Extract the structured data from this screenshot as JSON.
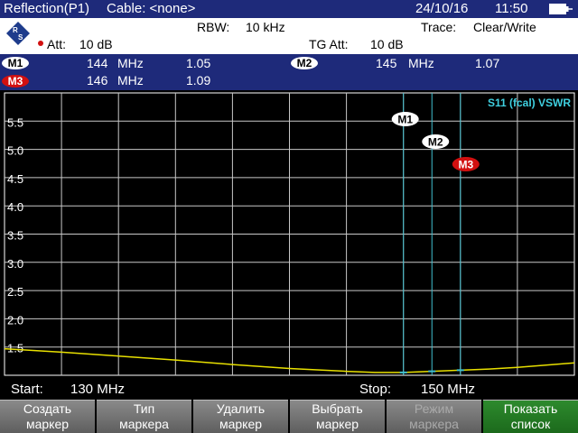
{
  "title_bar": {
    "mode": "Reflection(P1)",
    "cable": "Cable: <none>",
    "date": "24/10/16",
    "time": "11:50"
  },
  "info": {
    "rbw_label": "RBW:",
    "rbw_value": "10 kHz",
    "trace_label": "Trace:",
    "trace_value": "Clear/Write",
    "att_label": "Att:",
    "att_value": "10 dB",
    "tg_att_label": "TG Att:",
    "tg_att_value": "10 dB"
  },
  "markers": [
    {
      "label": "M1",
      "freq": "144",
      "unit": "MHz",
      "value": "1.05",
      "style": "white"
    },
    {
      "label": "M2",
      "freq": "145",
      "unit": "MHz",
      "value": "1.07",
      "style": "white"
    },
    {
      "label": "M3",
      "freq": "146",
      "unit": "MHz",
      "value": "1.09",
      "style": "red"
    }
  ],
  "plot": {
    "trace_label": "S11 (fcal) VSWR",
    "y_ticks": [
      "5.5",
      "5.0",
      "4.5",
      "4.0",
      "3.5",
      "3.0",
      "2.5",
      "2.0",
      "1.5"
    ]
  },
  "freq": {
    "start_label": "Start:",
    "start_value": "130 MHz",
    "stop_label": "Stop:",
    "stop_value": "150 MHz"
  },
  "softkeys": [
    {
      "line1": "Создать",
      "line2": "маркер",
      "state": "normal"
    },
    {
      "line1": "Тип",
      "line2": "маркера",
      "state": "normal"
    },
    {
      "line1": "Удалить",
      "line2": "маркер",
      "state": "normal"
    },
    {
      "line1": "Выбрать",
      "line2": "маркер",
      "state": "normal"
    },
    {
      "line1": "Режим",
      "line2": "маркера",
      "state": "disabled"
    },
    {
      "line1": "Показать",
      "line2": "список",
      "state": "active"
    }
  ],
  "chart_data": {
    "type": "line",
    "x_unit": "MHz",
    "xlim": [
      130,
      150
    ],
    "ylim": [
      1.0,
      6.0
    ],
    "x": [
      130,
      132,
      134,
      136,
      138,
      140,
      142,
      143,
      144,
      145,
      146,
      147,
      148,
      150
    ],
    "y": [
      1.47,
      1.41,
      1.34,
      1.27,
      1.19,
      1.12,
      1.07,
      1.05,
      1.05,
      1.07,
      1.09,
      1.11,
      1.14,
      1.22
    ],
    "markers": [
      {
        "label": "M1",
        "x": 144,
        "y": 1.05
      },
      {
        "label": "M2",
        "x": 145,
        "y": 1.07
      },
      {
        "label": "M3",
        "x": 146,
        "y": 1.09
      }
    ],
    "colors": {
      "trace": "#e8e000",
      "grid": "#ffffff",
      "marker_line": "#40c0d0"
    }
  }
}
